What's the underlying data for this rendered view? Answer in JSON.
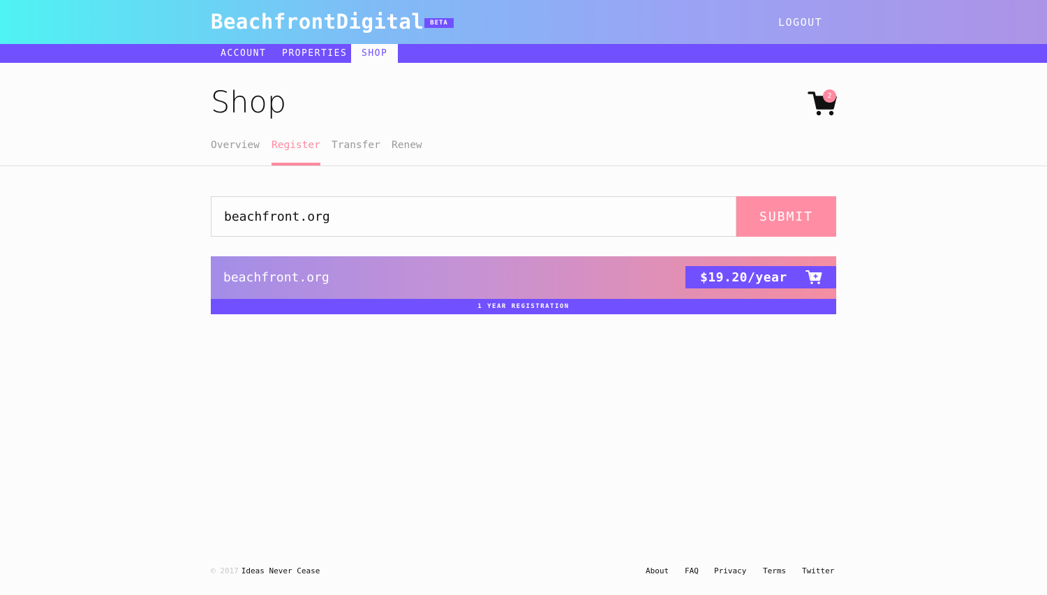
{
  "header": {
    "logo": "BeachfrontDigital",
    "badge": "BETA",
    "logout_label": "LOGOUT"
  },
  "nav": {
    "items": [
      {
        "label": "ACCOUNT"
      },
      {
        "label": "PROPERTIES"
      },
      {
        "label": "SHOP"
      }
    ],
    "active": "SHOP"
  },
  "page": {
    "title": "Shop",
    "cart_count": "2",
    "cart_icon": "shopping-cart-icon"
  },
  "subtabs": {
    "items": [
      {
        "label": "Overview"
      },
      {
        "label": "Register"
      },
      {
        "label": "Transfer"
      },
      {
        "label": "Renew"
      }
    ],
    "active": "Register"
  },
  "search": {
    "value": "beachfront.org",
    "submit_label": "SUBMIT"
  },
  "result": {
    "domain": "beachfront.org",
    "price": "$19.20/year",
    "add_icon": "add-to-cart-icon",
    "term": "1 YEAR REGISTRATION"
  },
  "footer": {
    "copyright": "© 2017",
    "brand": "Ideas Never Cease",
    "links": [
      {
        "label": "About"
      },
      {
        "label": "FAQ"
      },
      {
        "label": "Privacy"
      },
      {
        "label": "Terms"
      },
      {
        "label": "Twitter"
      }
    ]
  },
  "colors": {
    "accent_purple": "#7150ff",
    "accent_pink": "#ff8aa0",
    "header_gradient_start": "#4ff3f3",
    "header_gradient_end": "#ad93e6"
  }
}
